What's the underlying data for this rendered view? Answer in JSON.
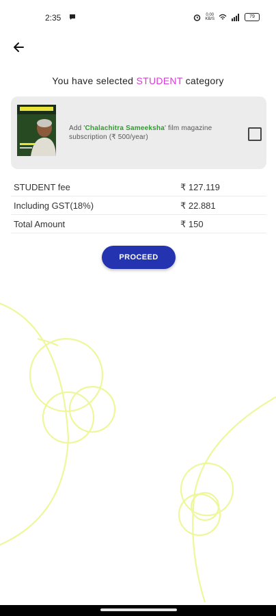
{
  "status_bar": {
    "time": "2:35",
    "net_speed_value": "0.00",
    "net_speed_unit": "KB/S",
    "battery": "79"
  },
  "page": {
    "headline_prefix": "You have selected ",
    "category": "STUDENT",
    "headline_suffix": " category",
    "accent_color": "#d63ad6"
  },
  "subscription": {
    "text_prefix": "Add '",
    "magazine_name": "Chalachitra Sameeksha",
    "text_suffix": "' film magazine subscription (₹ 500/year)",
    "checked": false
  },
  "fees": [
    {
      "label": "STUDENT fee",
      "value": "₹ 127.119"
    },
    {
      "label": "Including GST(18%)",
      "value": "₹ 22.881"
    },
    {
      "label": "Total Amount",
      "value": "₹ 150"
    }
  ],
  "actions": {
    "proceed_label": "PROCEED",
    "button_color": "#2434b0"
  }
}
